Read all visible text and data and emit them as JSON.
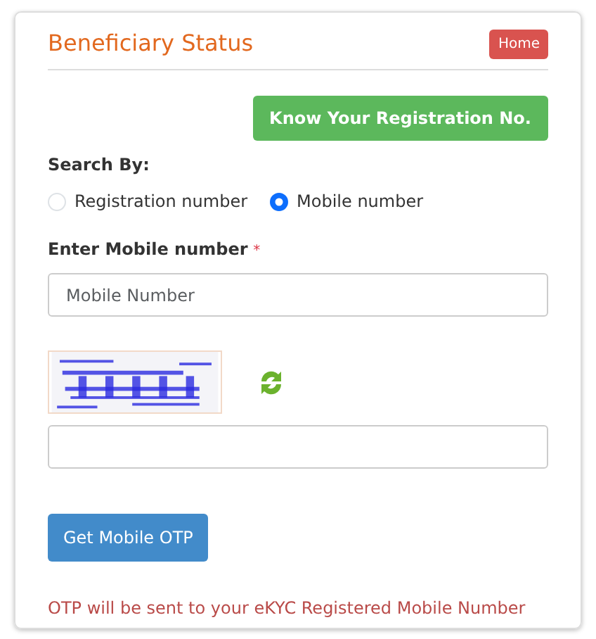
{
  "title": "Beneficiary Status",
  "home_button": "Home",
  "register_button": "Know Your Registration No.",
  "search_by": {
    "label": "Search By:",
    "options": [
      {
        "label": "Registration number",
        "selected": false
      },
      {
        "label": "Mobile number",
        "selected": true
      }
    ]
  },
  "mobile_field": {
    "label": "Enter Mobile number",
    "required_mark": "*",
    "placeholder": "Mobile Number"
  },
  "otp_button": "Get Mobile OTP",
  "note": "OTP will be sent to your eKYC Registered Mobile Number"
}
